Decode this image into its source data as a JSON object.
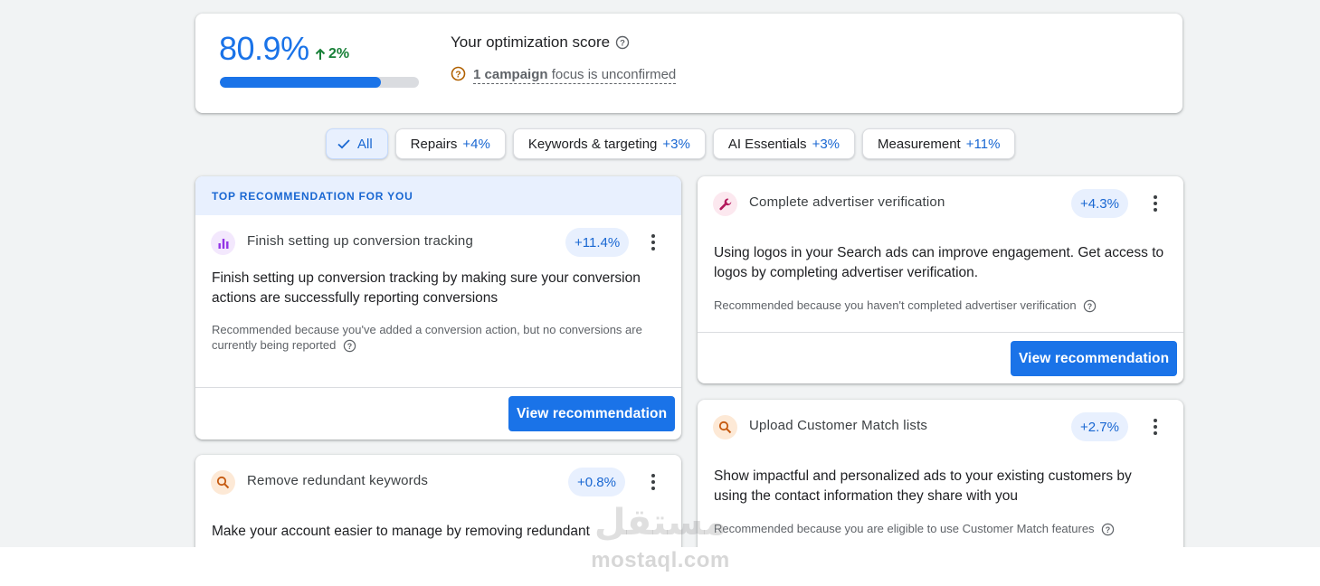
{
  "score": {
    "value": "80.9%",
    "delta": "2%",
    "progress": 0.809,
    "title": "Your optimization score",
    "unconfirmed_link": "1 campaign",
    "unconfirmed_text": " focus is unconfirmed"
  },
  "chips": [
    {
      "label": "All",
      "pct": "",
      "selected": true
    },
    {
      "label": "Repairs",
      "pct": "+4%"
    },
    {
      "label": "Keywords & targeting",
      "pct": "+3%"
    },
    {
      "label": "AI Essentials",
      "pct": "+3%"
    },
    {
      "label": "Measurement",
      "pct": "+11%"
    }
  ],
  "recommendations": {
    "top_banner": "TOP RECOMMENDATION FOR YOU",
    "view_label": "View recommendation",
    "conversion": {
      "title": "Finish setting up conversion tracking",
      "badge": "+11.4%",
      "desc": "Finish setting up conversion tracking by making sure your conversion actions are successfully reporting conversions",
      "reason": "Recommended because you've added a conversion action, but no conversions are currently being reported",
      "icon": "bar-chart-icon"
    },
    "keywords": {
      "title": "Remove redundant keywords",
      "badge": "+0.8%",
      "desc": "Make your account easier to manage by removing redundant",
      "icon": "search-icon"
    },
    "verification": {
      "title": "Complete advertiser verification",
      "badge": "+4.3%",
      "desc": "Using logos in your Search ads can improve engagement. Get access to logos by completing advertiser verification.",
      "reason": "Recommended because you haven't completed advertiser verification",
      "icon": "wrench-icon"
    },
    "customer_match": {
      "title": "Upload Customer Match lists",
      "badge": "+2.7%",
      "desc": "Show impactful and personalized ads to your existing customers by using the contact information they share with you",
      "reason": "Recommended because you are eligible to use Customer Match features",
      "icon": "search-icon"
    }
  },
  "watermark": {
    "arabic": "مستقل",
    "latin": "mostaql.com"
  },
  "colors": {
    "accent": "#1a73e8",
    "positive": "#188038",
    "background": "#f1f3f4"
  }
}
